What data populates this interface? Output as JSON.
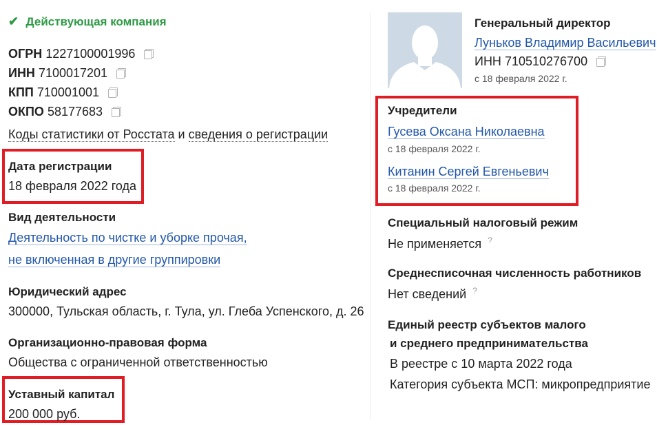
{
  "status": {
    "icon": "check-icon",
    "label": "Действующая компания",
    "color": "#2e9a45"
  },
  "identifiers": [
    {
      "label": "ОГРН",
      "value": "1227100001996"
    },
    {
      "label": "ИНН",
      "value": "7100017201"
    },
    {
      "label": "КПП",
      "value": "710001001"
    },
    {
      "label": "ОКПО",
      "value": "58177683"
    }
  ],
  "stats_link": {
    "part1": "Коды статистики от Росстата",
    "connector": "и",
    "part2": "сведения о регистрации"
  },
  "registration": {
    "title": "Дата регистрации",
    "value": "18 февраля 2022 года"
  },
  "activity": {
    "title": "Вид деятельности",
    "line1": "Деятельность по чистке и уборке прочая,",
    "line2": "не включенная в другие группировки"
  },
  "address": {
    "title": "Юридический адрес",
    "value": "300000, Тульская область, г. Тула, ул. Глеба Успенского, д. 26"
  },
  "legal_form": {
    "title": "Организационно-правовая форма",
    "value": "Общества с ограниченной ответственностью"
  },
  "capital": {
    "title": "Уставный капитал",
    "value": "200 000 руб."
  },
  "director": {
    "role": "Генеральный директор",
    "name": "Луньков Владимир Васильевич",
    "inn_label": "ИНН",
    "inn": "710510276700",
    "since": "с 18 февраля 2022 г."
  },
  "founders": {
    "title": "Учредители",
    "items": [
      {
        "name": "Гусева Оксана Николаевна",
        "since": "с 18 февраля 2022 г."
      },
      {
        "name": "Китанин Сергей Евгеньевич",
        "since": "с 18 февраля 2022 г."
      }
    ]
  },
  "tax_regime": {
    "title": "Специальный налоговый режим",
    "value": "Не применяется",
    "hint": "?"
  },
  "employees": {
    "title": "Среднесписочная численность работников",
    "value": "Нет сведений",
    "hint": "?"
  },
  "msp": {
    "title_line1": "Единый реестр субъектов малого",
    "title_line2": "и среднего предпринимательства",
    "value1": "В реестре с 10 марта 2022 года",
    "value2": "Категория субъекта МСП: микропредприятие",
    "hint": "?"
  },
  "colors": {
    "highlight": "#e01c24",
    "link": "#2358a8",
    "status": "#2e9a45"
  }
}
